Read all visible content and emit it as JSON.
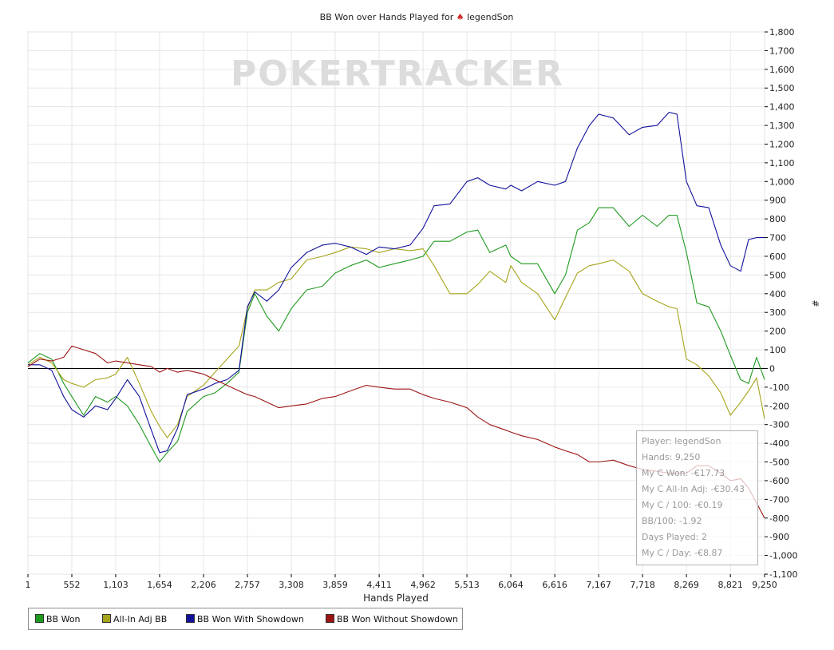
{
  "colors": {
    "background": "#ffffff",
    "grid": "#e6e6e6",
    "axis": "#000000",
    "bb_won": "#1f9a1f",
    "all_in_adj": "#a6a41a",
    "with_showdown": "#11119c",
    "without_showdown": "#9c1414"
  },
  "watermark": "POKERTRACKER",
  "tooltip": {
    "lines": [
      "Player: legendSon",
      "Hands: 9,250",
      "My C Won: -€17.73",
      "My C All-In Adj: -€30.43",
      "My C / 100: -€0.19",
      "BB/100: -1.92",
      "Days Played: 2",
      "My C / Day: -€8.87"
    ]
  },
  "chart_data": {
    "type": "line",
    "title": "BB Won over Hands Played for ♠ legendSon",
    "title_prefix": "BB Won over Hands Played for",
    "player_name": "legendSon",
    "xlabel": "Hands Played",
    "ylabel": "#",
    "xlim": [
      1,
      9250
    ],
    "ylim": [
      -1100,
      1800
    ],
    "grid": true,
    "legend_position": "bottom-left",
    "x_ticks": [
      1,
      552,
      1103,
      1654,
      2206,
      2757,
      3308,
      3859,
      4411,
      4962,
      5513,
      6064,
      6616,
      7167,
      7718,
      8269,
      8821,
      9250
    ],
    "x_tick_labels": [
      "1",
      "552",
      "1,103",
      "1,654",
      "2,206",
      "2,757",
      "3,308",
      "3,859",
      "4,411",
      "4,962",
      "5,513",
      "6,064",
      "6,616",
      "7,167",
      "7,718",
      "8,269",
      "8,821",
      "9,250"
    ],
    "y_ticks": [
      -1100,
      -1000,
      -900,
      -800,
      -700,
      -600,
      -500,
      -400,
      -300,
      -200,
      -100,
      0,
      100,
      200,
      300,
      400,
      500,
      600,
      700,
      800,
      900,
      1000,
      1100,
      1200,
      1300,
      1400,
      1500,
      1600,
      1700,
      1800
    ],
    "y_tick_labels": [
      "-1,100",
      "-1,000",
      "-900",
      "-800",
      "-700",
      "-600",
      "-500",
      "-400",
      "-300",
      "-200",
      "-100",
      "0",
      "100",
      "200",
      "300",
      "400",
      "500",
      "600",
      "700",
      "800",
      "900",
      "1,000",
      "1,100",
      "1,200",
      "1,300",
      "1,400",
      "1,500",
      "1,600",
      "1,700",
      "1,800"
    ],
    "series": [
      {
        "name": "BB Won",
        "color": "#1f9a1f",
        "points": [
          [
            1,
            30
          ],
          [
            150,
            80
          ],
          [
            300,
            50
          ],
          [
            450,
            -80
          ],
          [
            552,
            -150
          ],
          [
            700,
            -250
          ],
          [
            850,
            -150
          ],
          [
            1000,
            -180
          ],
          [
            1103,
            -150
          ],
          [
            1250,
            -200
          ],
          [
            1400,
            -300
          ],
          [
            1550,
            -420
          ],
          [
            1654,
            -500
          ],
          [
            1750,
            -450
          ],
          [
            1880,
            -390
          ],
          [
            2000,
            -230
          ],
          [
            2206,
            -150
          ],
          [
            2350,
            -130
          ],
          [
            2500,
            -80
          ],
          [
            2650,
            -20
          ],
          [
            2757,
            300
          ],
          [
            2850,
            400
          ],
          [
            3000,
            280
          ],
          [
            3150,
            200
          ],
          [
            3308,
            320
          ],
          [
            3500,
            420
          ],
          [
            3700,
            440
          ],
          [
            3859,
            510
          ],
          [
            4050,
            550
          ],
          [
            4250,
            580
          ],
          [
            4411,
            540
          ],
          [
            4600,
            560
          ],
          [
            4800,
            580
          ],
          [
            4962,
            600
          ],
          [
            5100,
            680
          ],
          [
            5300,
            680
          ],
          [
            5513,
            730
          ],
          [
            5650,
            740
          ],
          [
            5800,
            620
          ],
          [
            6000,
            660
          ],
          [
            6064,
            600
          ],
          [
            6200,
            560
          ],
          [
            6400,
            560
          ],
          [
            6616,
            400
          ],
          [
            6750,
            500
          ],
          [
            6900,
            740
          ],
          [
            7050,
            780
          ],
          [
            7167,
            860
          ],
          [
            7350,
            860
          ],
          [
            7550,
            760
          ],
          [
            7718,
            820
          ],
          [
            7900,
            760
          ],
          [
            8050,
            820
          ],
          [
            8150,
            820
          ],
          [
            8269,
            620
          ],
          [
            8400,
            350
          ],
          [
            8550,
            330
          ],
          [
            8700,
            200
          ],
          [
            8821,
            70
          ],
          [
            8950,
            -60
          ],
          [
            9050,
            -80
          ],
          [
            9150,
            60
          ],
          [
            9250,
            -60
          ]
        ]
      },
      {
        "name": "All-In Adj BB",
        "color": "#a6a41a",
        "points": [
          [
            1,
            20
          ],
          [
            150,
            60
          ],
          [
            300,
            30
          ],
          [
            450,
            -60
          ],
          [
            552,
            -80
          ],
          [
            700,
            -100
          ],
          [
            850,
            -60
          ],
          [
            1000,
            -50
          ],
          [
            1103,
            -30
          ],
          [
            1250,
            60
          ],
          [
            1400,
            -80
          ],
          [
            1550,
            -230
          ],
          [
            1654,
            -310
          ],
          [
            1750,
            -370
          ],
          [
            1880,
            -300
          ],
          [
            2000,
            -150
          ],
          [
            2206,
            -90
          ],
          [
            2350,
            -20
          ],
          [
            2500,
            50
          ],
          [
            2650,
            120
          ],
          [
            2757,
            320
          ],
          [
            2850,
            420
          ],
          [
            3000,
            420
          ],
          [
            3150,
            460
          ],
          [
            3308,
            480
          ],
          [
            3500,
            580
          ],
          [
            3700,
            600
          ],
          [
            3859,
            620
          ],
          [
            4050,
            650
          ],
          [
            4250,
            640
          ],
          [
            4411,
            620
          ],
          [
            4600,
            640
          ],
          [
            4800,
            630
          ],
          [
            4962,
            640
          ],
          [
            5100,
            550
          ],
          [
            5300,
            400
          ],
          [
            5513,
            400
          ],
          [
            5650,
            450
          ],
          [
            5800,
            520
          ],
          [
            6000,
            460
          ],
          [
            6064,
            550
          ],
          [
            6200,
            460
          ],
          [
            6400,
            400
          ],
          [
            6616,
            260
          ],
          [
            6750,
            380
          ],
          [
            6900,
            510
          ],
          [
            7050,
            550
          ],
          [
            7167,
            560
          ],
          [
            7350,
            580
          ],
          [
            7550,
            520
          ],
          [
            7718,
            400
          ],
          [
            7900,
            360
          ],
          [
            8050,
            330
          ],
          [
            8150,
            320
          ],
          [
            8269,
            50
          ],
          [
            8400,
            20
          ],
          [
            8550,
            -40
          ],
          [
            8700,
            -130
          ],
          [
            8821,
            -250
          ],
          [
            8950,
            -180
          ],
          [
            9050,
            -120
          ],
          [
            9150,
            -50
          ],
          [
            9250,
            -270
          ]
        ]
      },
      {
        "name": "BB Won With Showdown",
        "color": "#11119c",
        "points": [
          [
            1,
            20
          ],
          [
            150,
            20
          ],
          [
            300,
            -10
          ],
          [
            450,
            -150
          ],
          [
            552,
            -220
          ],
          [
            700,
            -260
          ],
          [
            850,
            -200
          ],
          [
            1000,
            -220
          ],
          [
            1103,
            -160
          ],
          [
            1250,
            -60
          ],
          [
            1400,
            -150
          ],
          [
            1550,
            -330
          ],
          [
            1654,
            -450
          ],
          [
            1750,
            -440
          ],
          [
            1880,
            -320
          ],
          [
            2000,
            -140
          ],
          [
            2206,
            -110
          ],
          [
            2350,
            -80
          ],
          [
            2500,
            -60
          ],
          [
            2650,
            -10
          ],
          [
            2757,
            330
          ],
          [
            2850,
            410
          ],
          [
            3000,
            360
          ],
          [
            3150,
            420
          ],
          [
            3308,
            540
          ],
          [
            3500,
            620
          ],
          [
            3700,
            660
          ],
          [
            3859,
            670
          ],
          [
            4050,
            650
          ],
          [
            4250,
            610
          ],
          [
            4411,
            650
          ],
          [
            4600,
            640
          ],
          [
            4800,
            660
          ],
          [
            4962,
            750
          ],
          [
            5100,
            870
          ],
          [
            5300,
            880
          ],
          [
            5513,
            1000
          ],
          [
            5650,
            1020
          ],
          [
            5800,
            980
          ],
          [
            6000,
            960
          ],
          [
            6064,
            980
          ],
          [
            6200,
            950
          ],
          [
            6400,
            1000
          ],
          [
            6616,
            980
          ],
          [
            6750,
            1000
          ],
          [
            6900,
            1180
          ],
          [
            7050,
            1300
          ],
          [
            7167,
            1360
          ],
          [
            7350,
            1340
          ],
          [
            7550,
            1250
          ],
          [
            7718,
            1290
          ],
          [
            7900,
            1300
          ],
          [
            8050,
            1370
          ],
          [
            8150,
            1360
          ],
          [
            8269,
            1000
          ],
          [
            8400,
            870
          ],
          [
            8550,
            860
          ],
          [
            8700,
            660
          ],
          [
            8821,
            550
          ],
          [
            8950,
            520
          ],
          [
            9050,
            690
          ],
          [
            9150,
            700
          ],
          [
            9250,
            700
          ]
        ]
      },
      {
        "name": "BB Won Without Showdown",
        "color": "#9c1414",
        "points": [
          [
            1,
            10
          ],
          [
            150,
            50
          ],
          [
            300,
            40
          ],
          [
            450,
            60
          ],
          [
            552,
            120
          ],
          [
            700,
            100
          ],
          [
            850,
            80
          ],
          [
            1000,
            30
          ],
          [
            1103,
            40
          ],
          [
            1250,
            30
          ],
          [
            1400,
            20
          ],
          [
            1550,
            10
          ],
          [
            1654,
            -20
          ],
          [
            1750,
            0
          ],
          [
            1880,
            -20
          ],
          [
            2000,
            -10
          ],
          [
            2206,
            -30
          ],
          [
            2350,
            -60
          ],
          [
            2500,
            -90
          ],
          [
            2650,
            -120
          ],
          [
            2757,
            -140
          ],
          [
            2850,
            -150
          ],
          [
            3000,
            -180
          ],
          [
            3150,
            -210
          ],
          [
            3308,
            -200
          ],
          [
            3500,
            -190
          ],
          [
            3700,
            -160
          ],
          [
            3859,
            -150
          ],
          [
            4050,
            -120
          ],
          [
            4250,
            -90
          ],
          [
            4411,
            -100
          ],
          [
            4600,
            -110
          ],
          [
            4800,
            -110
          ],
          [
            4962,
            -140
          ],
          [
            5100,
            -160
          ],
          [
            5300,
            -180
          ],
          [
            5513,
            -210
          ],
          [
            5650,
            -260
          ],
          [
            5800,
            -300
          ],
          [
            6000,
            -330
          ],
          [
            6064,
            -340
          ],
          [
            6200,
            -360
          ],
          [
            6400,
            -380
          ],
          [
            6616,
            -420
          ],
          [
            6750,
            -440
          ],
          [
            6900,
            -460
          ],
          [
            7050,
            -500
          ],
          [
            7167,
            -500
          ],
          [
            7350,
            -490
          ],
          [
            7550,
            -520
          ],
          [
            7718,
            -540
          ],
          [
            7900,
            -550
          ],
          [
            8050,
            -560
          ],
          [
            8150,
            -560
          ],
          [
            8269,
            -560
          ],
          [
            8400,
            -520
          ],
          [
            8550,
            -520
          ],
          [
            8700,
            -560
          ],
          [
            8821,
            -600
          ],
          [
            8950,
            -590
          ],
          [
            9050,
            -640
          ],
          [
            9150,
            -720
          ],
          [
            9250,
            -800
          ]
        ]
      }
    ]
  }
}
